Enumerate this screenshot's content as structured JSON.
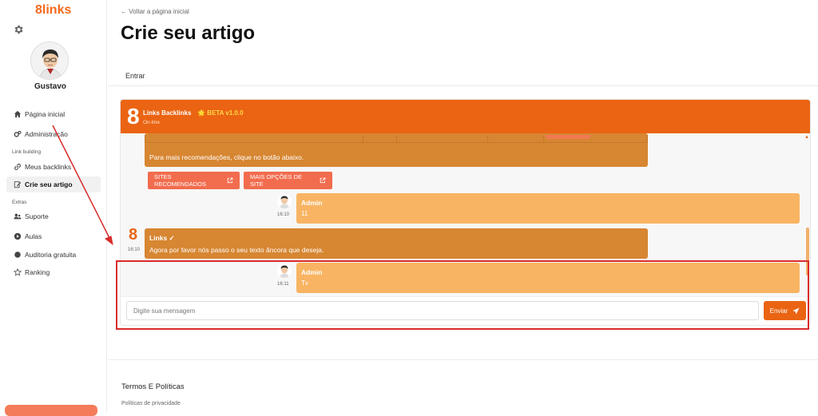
{
  "sidebar": {
    "logo": "8links",
    "user_name": "Gustavo",
    "items": [
      {
        "label": "Página inicial"
      },
      {
        "label": "Administração"
      },
      {
        "label": "Meus backlinks"
      },
      {
        "label": "Crie seu artigo"
      },
      {
        "label": "Suporte"
      },
      {
        "label": "Aulas"
      },
      {
        "label": "Auditoria gratuita"
      },
      {
        "label": "Ranking"
      }
    ],
    "sections": {
      "link_building": "Link building",
      "extras": "Extras"
    }
  },
  "header": {
    "back_link": "← Voltar a página inicial",
    "title": "Crie seu artigo",
    "tab": "Entrar"
  },
  "chat": {
    "brand_number": "8",
    "title": "Links Backlinks",
    "beta": "🌟 BETA v1.0.0",
    "status": "On-line",
    "messages": {
      "recommend_text": "Para mais recomendações, clique no botão abaixo.",
      "btn_sites": "SITES RECOMENDADOS",
      "btn_options": "MAIS OPÇÕES DE SITE",
      "admin1_name": "Admin",
      "admin1_text": "11",
      "admin1_time": "16:10",
      "bot_name": "Links ✓",
      "bot_text": "Agora por favor nós passo o seu texto âncora que deseja.",
      "bot_time": "16:10",
      "admin2_name": "Admin",
      "admin2_text": "Tv",
      "admin2_time": "16:11"
    },
    "composer": {
      "placeholder": "Digite sua mensagem",
      "send_label": "Enviar"
    }
  },
  "footer": {
    "title": "Termos E Políticas",
    "privacy": "Políticas de privacidade"
  },
  "colors": {
    "brand": "#ea6413",
    "bot_bubble": "#d78632",
    "user_bubble": "#f8b462",
    "annotation": "#d92b2b"
  }
}
